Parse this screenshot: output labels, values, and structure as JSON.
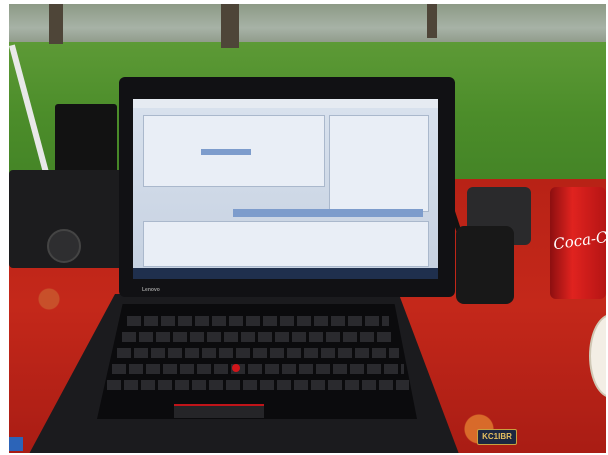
{
  "photo": {
    "description_icons": [
      "laptop-icon",
      "radio-icon",
      "soda-can-icon",
      "camera-icon",
      "handheld-radio-icon"
    ],
    "laptop": {
      "screen_title": "",
      "brand": "Lenovo"
    },
    "can": {
      "label": "Coca-Cola"
    },
    "badge": {
      "text": "KC1IBR"
    },
    "colors": {
      "grass": "#4c8d2a",
      "tablecloth": "#c4281a",
      "screen": "#d9e2ee",
      "laptop": "#111114"
    }
  }
}
